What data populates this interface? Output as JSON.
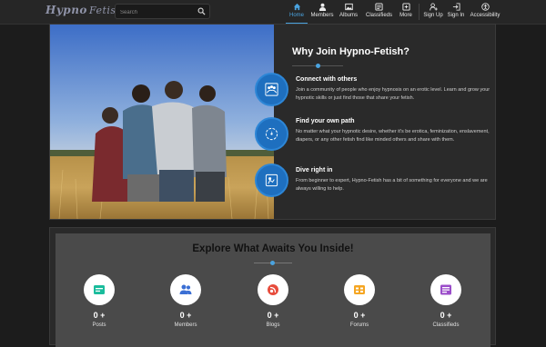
{
  "header": {
    "logo_part1": "Hypno",
    "logo_part2": "Fetish",
    "search_placeholder": "Search",
    "nav": [
      {
        "label": "Home",
        "icon": "home-icon",
        "active": true
      },
      {
        "label": "Members",
        "icon": "person-icon"
      },
      {
        "label": "Albums",
        "icon": "image-icon"
      },
      {
        "label": "Classifieds",
        "icon": "classifieds-icon"
      },
      {
        "label": "More",
        "icon": "more-icon"
      },
      {
        "label": "Sign Up",
        "icon": "add-user-icon"
      },
      {
        "label": "Sign In",
        "icon": "sign-in-icon"
      },
      {
        "label": "Accessibility",
        "icon": "accessibility-icon"
      }
    ]
  },
  "why": {
    "title": "Why Join Hypno-Fetish?",
    "features": [
      {
        "title": "Connect with others",
        "desc": "Join a community of people who enjoy hypnosis on an erotic level. Learn and grow your hypnotic skills or just find those that share your fetish.",
        "icon": "community-icon"
      },
      {
        "title": "Find your own path",
        "desc": "No matter what your hypnotic desire, whether it's be erotica, feminization, enslavement, diapers, or any other fetish find like minded others and share with them.",
        "icon": "compass-icon"
      },
      {
        "title": "Dive right in",
        "desc": "From beginner to expert, Hypno-Fetish has a bit of something for everyone and we are always willing to help.",
        "icon": "dive-icon"
      }
    ]
  },
  "explore": {
    "title": "Explore What Awaits You Inside!",
    "stats": [
      {
        "value": "0 +",
        "label": "Posts",
        "icon": "posts-icon",
        "color": "#1abc9c"
      },
      {
        "value": "0 +",
        "label": "Members",
        "icon": "members-icon",
        "color": "#3b6fd4"
      },
      {
        "value": "0 +",
        "label": "Blogs",
        "icon": "blogs-icon",
        "color": "#e74c3c"
      },
      {
        "value": "0 +",
        "label": "Forums",
        "icon": "forums-icon",
        "color": "#f5a623"
      },
      {
        "value": "0 +",
        "label": "Classifieds",
        "icon": "classifieds-icon",
        "color": "#9b4dca"
      }
    ]
  },
  "colors": {
    "accent": "#4aa3df",
    "feature_circle": "#1e6fbf"
  }
}
